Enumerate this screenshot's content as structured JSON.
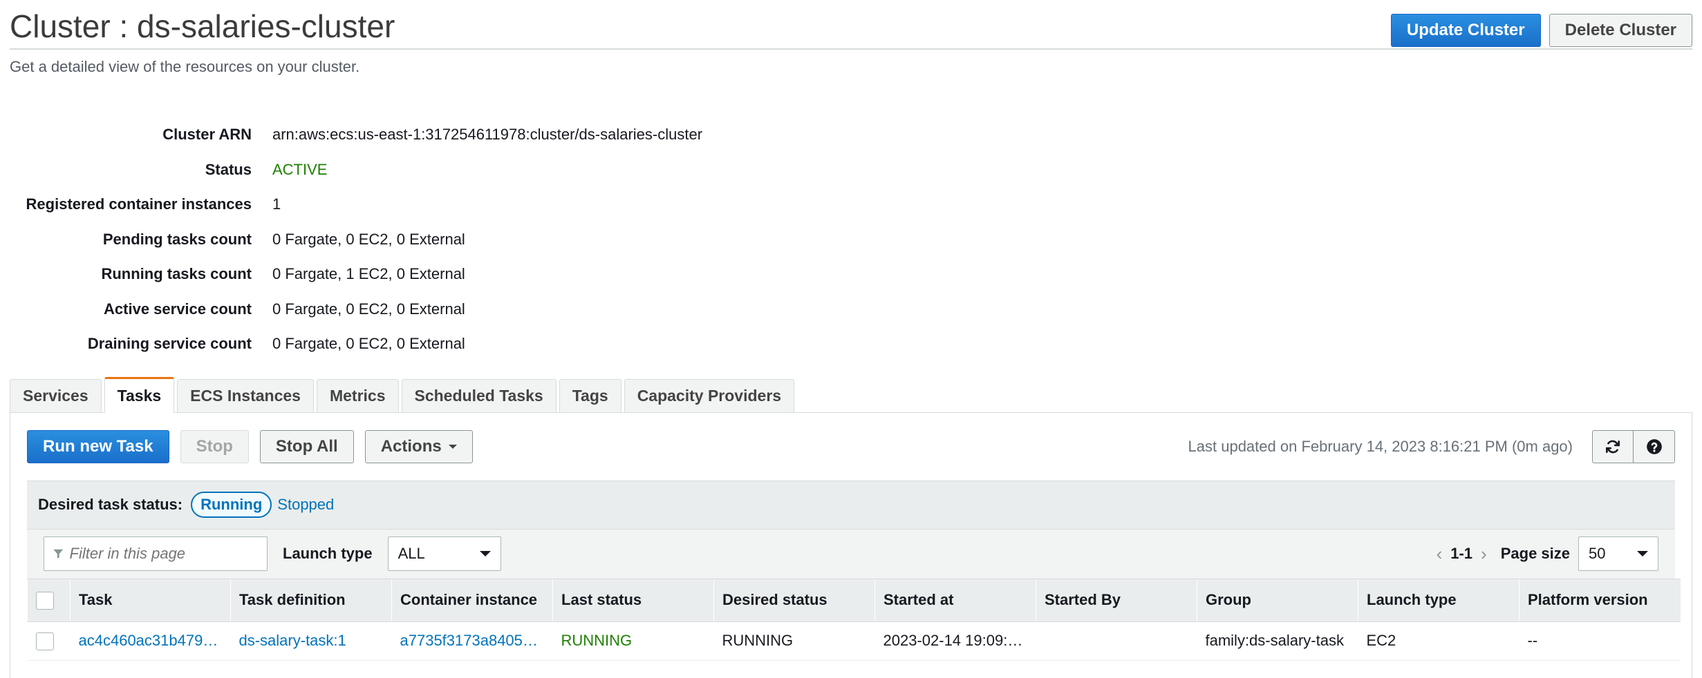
{
  "header": {
    "title": "Cluster : ds-salaries-cluster",
    "subtitle": "Get a detailed view of the resources on your cluster.",
    "update_label": "Update Cluster",
    "delete_label": "Delete Cluster"
  },
  "details": [
    {
      "label": "Cluster ARN",
      "value": "arn:aws:ecs:us-east-1:317254611978:cluster/ds-salaries-cluster"
    },
    {
      "label": "Status",
      "value": "ACTIVE"
    },
    {
      "label": "Registered container instances",
      "value": "1"
    },
    {
      "label": "Pending tasks count",
      "value": "0 Fargate, 0 EC2, 0 External"
    },
    {
      "label": "Running tasks count",
      "value": "0 Fargate, 1 EC2, 0 External"
    },
    {
      "label": "Active service count",
      "value": "0 Fargate, 0 EC2, 0 External"
    },
    {
      "label": "Draining service count",
      "value": "0 Fargate, 0 EC2, 0 External"
    }
  ],
  "tabs": [
    "Services",
    "Tasks",
    "ECS Instances",
    "Metrics",
    "Scheduled Tasks",
    "Tags",
    "Capacity Providers"
  ],
  "active_tab": "Tasks",
  "toolbar": {
    "run_label": "Run new Task",
    "stop_label": "Stop",
    "stop_all_label": "Stop All",
    "actions_label": "Actions",
    "last_updated": "Last updated on February 14, 2023 8:16:21 PM (0m ago)",
    "refresh_icon": "refresh-icon",
    "help_icon": "help-icon"
  },
  "status_filter": {
    "label": "Desired task status:",
    "running": "Running",
    "stopped": "Stopped"
  },
  "filter": {
    "placeholder": "Filter in this page",
    "launch_type_label": "Launch type",
    "launch_type_value": "ALL",
    "range": "1-1",
    "page_size_label": "Page size",
    "page_size_value": "50"
  },
  "table": {
    "columns": [
      "Task",
      "Task definition",
      "Container instance",
      "Last status",
      "Desired status",
      "Started at",
      "Started By",
      "Group",
      "Launch type",
      "Platform version"
    ],
    "rows": [
      {
        "task": "ac4c460ac31b479…",
        "task_definition": "ds-salary-task:1",
        "container_instance": "a7735f3173a8405…",
        "last_status": "RUNNING",
        "desired_status": "RUNNING",
        "started_at": "2023-02-14 19:09:…",
        "started_by": "",
        "group": "family:ds-salary-task",
        "launch_type": "EC2",
        "platform_version": "--"
      }
    ]
  },
  "colors": {
    "primary": "#1a6fca",
    "link": "#0073bb",
    "active_status": "#1d8102",
    "tab_accent": "#ec7211"
  }
}
